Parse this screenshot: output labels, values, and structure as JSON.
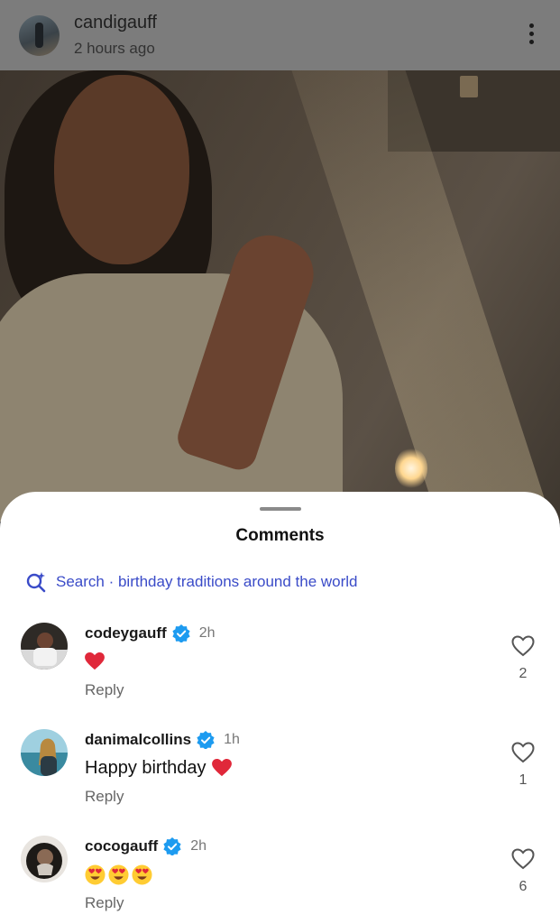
{
  "post": {
    "username": "candigauff",
    "time": "2 hours ago",
    "menu_icon": "more-vertical-icon"
  },
  "sheet": {
    "title": "Comments",
    "search_text": "Search · birthday traditions around the world",
    "search_icon": "search-sparkle-icon"
  },
  "comments": [
    {
      "username": "codeygauff",
      "time": "2h",
      "text": "",
      "emoji": [
        "red-heart"
      ],
      "reply_label": "Reply",
      "likes": "2",
      "verified": true
    },
    {
      "username": "danimalcollins",
      "time": "1h",
      "text": "Happy birthday",
      "emoji": [
        "red-heart"
      ],
      "reply_label": "Reply",
      "likes": "1",
      "verified": true
    },
    {
      "username": "cocogauff",
      "time": "2h",
      "text": "",
      "emoji": [
        "heart-eyes",
        "heart-eyes",
        "heart-eyes"
      ],
      "reply_label": "Reply",
      "likes": "6",
      "verified": true
    }
  ],
  "colors": {
    "accent": "#3a4bc8",
    "verified": "#1d9bf0",
    "heart": "#e0283a",
    "overlay_header": "#7c7c7c"
  }
}
